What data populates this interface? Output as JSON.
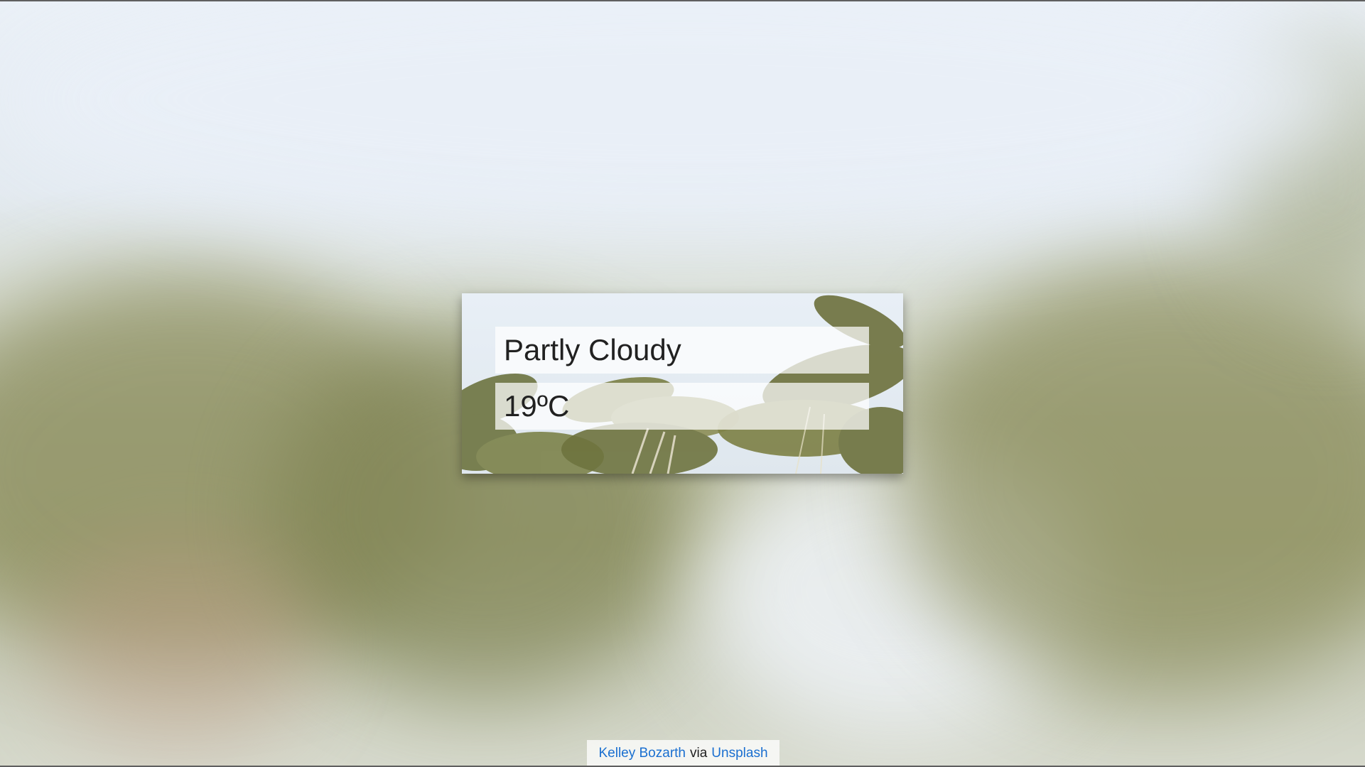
{
  "weather": {
    "condition": "Partly Cloudy",
    "temperature": "19ºC"
  },
  "credit": {
    "photographer": "Kelley Bozarth",
    "via": "via",
    "source": "Unsplash"
  },
  "colors": {
    "link": "#1a6fd0",
    "text": "#212121",
    "panel": "rgba(255,255,255,0.72)"
  }
}
